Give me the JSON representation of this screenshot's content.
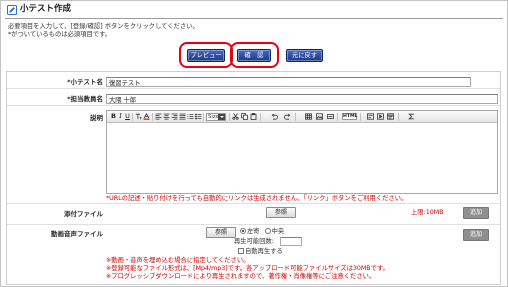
{
  "header": {
    "title": "小テスト作成",
    "icon": "edit-document-icon"
  },
  "instructions": [
    "必要項目を入力して、[登録/確認] ボタンをクリックしてください。",
    "*がついているものは必須項目です。"
  ],
  "actions": {
    "preview": "プレビュー",
    "confirm": "確　認",
    "reset": "元に戻す"
  },
  "form": {
    "quiz_name": {
      "label": "*小テスト名",
      "value": "復習テスト"
    },
    "teacher": {
      "label": "*担当教員名",
      "value": "大隈 十郎"
    },
    "description": {
      "label": "説明",
      "value": "",
      "note": "*URLの記述・貼り付けを行っても自動的にリンクは生成されません。「リンク」ボタンをご利用ください。"
    },
    "attachment": {
      "label": "添付ファイル",
      "browse": "参照",
      "limit": "上限:10MB",
      "add": "追加"
    },
    "media": {
      "label": "動画音声ファイル",
      "browse": "参照",
      "align_options": [
        "左寄",
        "中央"
      ],
      "align_selected": "左寄",
      "play_count_label": "再生可能回数:",
      "play_count_value": "",
      "autoplay_label": "自動再生する",
      "autoplay_checked": false,
      "add": "追加",
      "notes": [
        "※動画・音声を埋め込む場合に指定してください。",
        "※登録可能なファイル形式は、[Mp4/mp3]です。各アップロード可能ファイルサイズは30MBです。",
        "※プログレッシブダウンロードにより再生されますので、著作権・肖像権等にご注意ください。"
      ]
    }
  },
  "editor": {
    "toolbar": {
      "bold": "B",
      "italic": "I",
      "underline": "U",
      "font_size": "Size",
      "source": "HTML",
      "icons": [
        "font-format-icon",
        "text-color-icon",
        "align-left-icon",
        "align-center-icon",
        "align-right-icon",
        "align-justify-icon",
        "ordered-list-icon",
        "bullet-list-icon",
        "cut-icon",
        "copy-icon",
        "paste-icon",
        "undo-icon",
        "redo-icon",
        "table-icon",
        "image-icon",
        "insert-box-icon",
        "special-char-icon",
        "media-icon",
        "preview-icon",
        "sigma-icon"
      ]
    }
  },
  "colors": {
    "primary_button": "#1b3987",
    "highlight_annotation": "#e60012",
    "warning_text": "#d40000",
    "add_button": "#8f8f8f"
  }
}
